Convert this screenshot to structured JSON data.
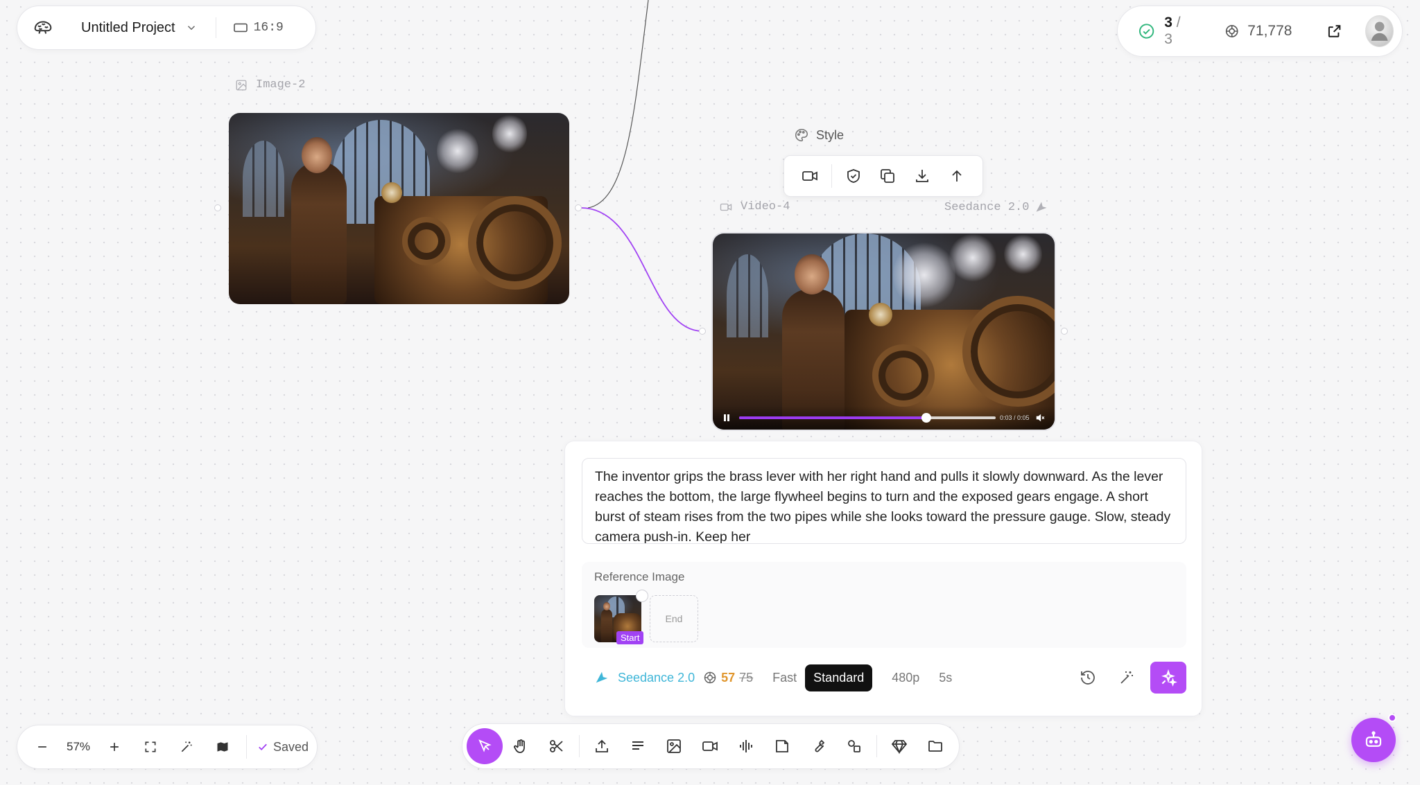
{
  "project": {
    "title": "Untitled Project",
    "aspect_ratio": "16:9"
  },
  "status": {
    "tasks_done": "3",
    "tasks_sep": "/",
    "tasks_total": "3",
    "credits": "71,778"
  },
  "nodes": {
    "image": {
      "label": "Image-2"
    },
    "video": {
      "label": "Video-4",
      "model": "Seedance 2.0",
      "time": "0:03 / 0:05",
      "progress": 0.73
    },
    "style": {
      "label": "Style"
    }
  },
  "prompt": {
    "text": "The inventor grips the brass lever with her right hand and pulls it slowly downward. As the lever reaches the bottom, the large flywheel begins to turn and the exposed gears engage. A short burst of steam rises from the two pipes while she looks toward the pressure gauge. Slow, steady camera push-in. Keep her",
    "reference_label": "Reference Image",
    "start_label": "Start",
    "end_label": "End"
  },
  "options": {
    "model": "Seedance 2.0",
    "cost": "57",
    "cost_original": "75",
    "speed_fast": "Fast",
    "speed_standard": "Standard",
    "resolution": "480p",
    "duration": "5s"
  },
  "bottom_left": {
    "zoom": "57%",
    "saved": "Saved"
  },
  "colors": {
    "accent": "#b44cf6",
    "model": "#3fb6d8",
    "cost": "#e0962d",
    "success": "#2fb67c",
    "edge": "#a142f4"
  },
  "icons": {
    "logo": "brain-logo-icon",
    "toolbar": [
      "pointer-icon",
      "hand-icon",
      "scissors-icon",
      "upload-icon",
      "text-icon",
      "image-icon",
      "video-icon",
      "audio-wave-icon",
      "note-icon",
      "wrench-icon",
      "shapes-icon",
      "diamond-icon",
      "folder-icon"
    ],
    "video_toolbar": [
      "video-icon",
      "shield-check-icon",
      "copy-icon",
      "download-icon",
      "arrow-up-icon"
    ]
  }
}
